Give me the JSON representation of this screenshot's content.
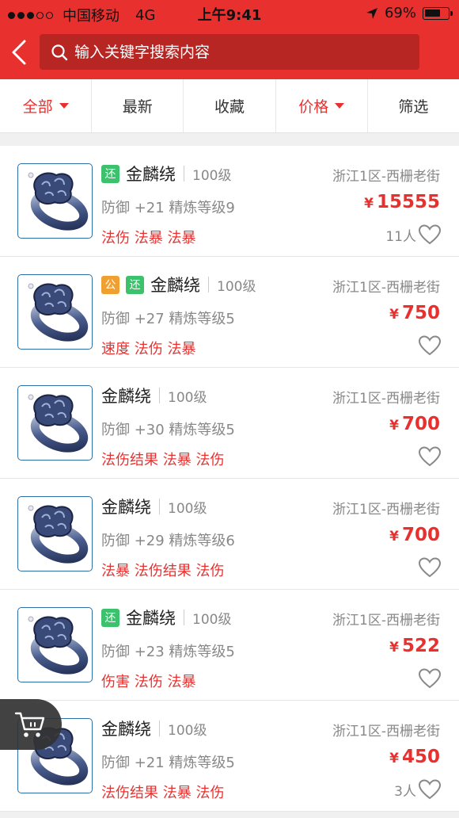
{
  "status_bar": {
    "signal": "●●●○○",
    "carrier": "中国移动",
    "network": "4G",
    "time": "上午9:41",
    "battery_pct": "69%",
    "battery_level": 0.69
  },
  "search": {
    "placeholder": "输入关键字搜索内容"
  },
  "filters": [
    {
      "label": "全部",
      "active": true,
      "dropdown": true
    },
    {
      "label": "最新",
      "active": false,
      "dropdown": false
    },
    {
      "label": "收藏",
      "active": false,
      "dropdown": false
    },
    {
      "label": "价格",
      "active": true,
      "dropdown": true
    },
    {
      "label": "筛选",
      "active": false,
      "dropdown": false
    }
  ],
  "currency_symbol": "¥",
  "items": [
    {
      "tags": [
        "还"
      ],
      "name": "金麟绕",
      "level": "100级",
      "server": "浙江1区-西栅老街",
      "attrs": "防御 +21 精炼等级9",
      "price": "15555",
      "skills": "法伤 法暴 法暴",
      "fav_count": "11人"
    },
    {
      "tags": [
        "公",
        "还"
      ],
      "name": "金麟绕",
      "level": "100级",
      "server": "浙江1区-西栅老街",
      "attrs": "防御 +27 精炼等级5",
      "price": "750",
      "skills": "速度 法伤 法暴",
      "fav_count": ""
    },
    {
      "tags": [],
      "name": "金麟绕",
      "level": "100级",
      "server": "浙江1区-西栅老街",
      "attrs": "防御 +30 精炼等级5",
      "price": "700",
      "skills": "法伤结果 法暴 法伤",
      "fav_count": ""
    },
    {
      "tags": [],
      "name": "金麟绕",
      "level": "100级",
      "server": "浙江1区-西栅老街",
      "attrs": "防御 +29 精炼等级6",
      "price": "700",
      "skills": "法暴 法伤结果 法伤",
      "fav_count": ""
    },
    {
      "tags": [
        "还"
      ],
      "name": "金麟绕",
      "level": "100级",
      "server": "浙江1区-西栅老街",
      "attrs": "防御 +23 精炼等级5",
      "price": "522",
      "skills": "伤害 法伤 法暴",
      "fav_count": ""
    },
    {
      "tags": [],
      "name": "金麟绕",
      "level": "100级",
      "server": "浙江1区-西栅老街",
      "attrs": "防御 +21 精炼等级5",
      "price": "450",
      "skills": "法伤结果 法暴 法伤",
      "fav_count": "3人"
    }
  ],
  "colors": {
    "brand_red": "#e8312f",
    "tag_green": "#3cc16d",
    "tag_orange": "#f0a030"
  },
  "icons": {
    "back": "chevron-left-icon",
    "search": "search-icon",
    "heart": "heart-outline-icon",
    "cart": "shopping-cart-icon",
    "thumb": "ring-item-icon"
  }
}
